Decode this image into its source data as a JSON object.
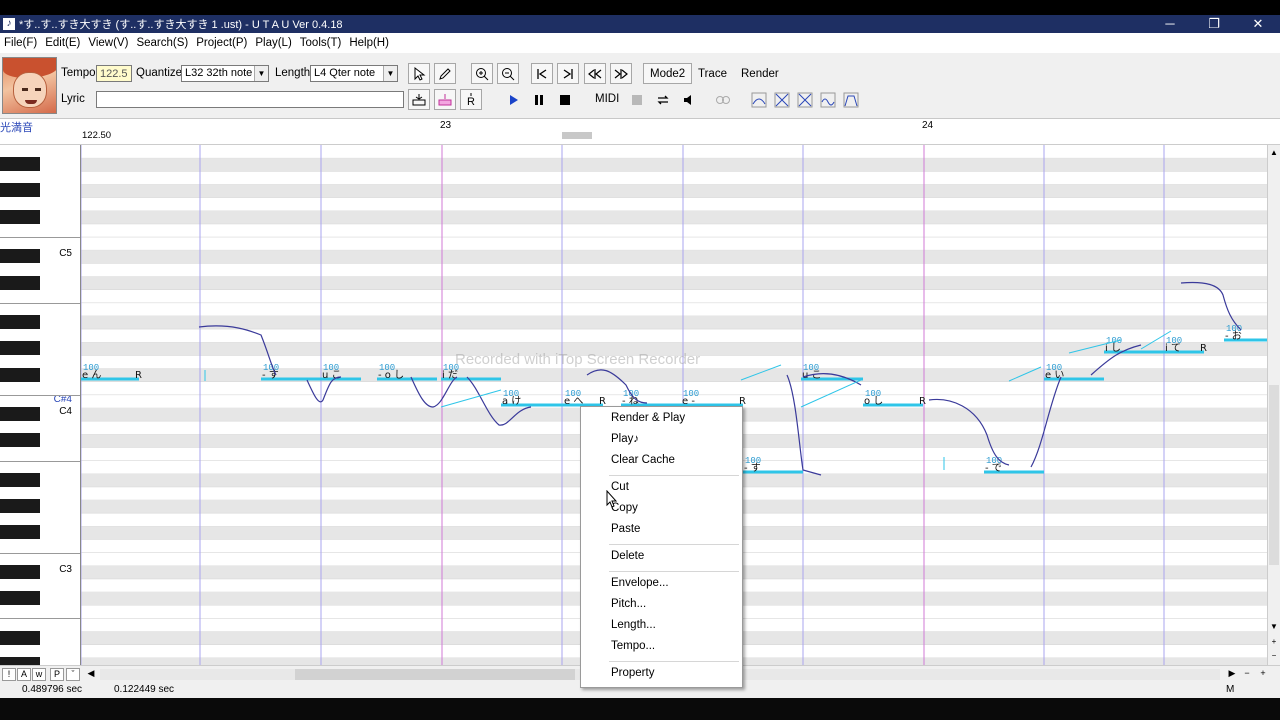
{
  "window": {
    "title": "*す..す..すき大すき (す..す..すき大すき 1 .ust) - U T A U Ver 0.4.18",
    "app_icon": "♪",
    "minimize": "─",
    "maximize": "❐",
    "close": "✕"
  },
  "menu": [
    "File(F)",
    "Edit(E)",
    "View(V)",
    "Search(S)",
    "Project(P)",
    "Play(L)",
    "Tools(T)",
    "Help(H)"
  ],
  "toolbar": {
    "tempo_label": "Tempo",
    "tempo_value": "122.5",
    "quantize_label": "Quantize",
    "quantize_value": "L32 32th note",
    "length_label": "Length",
    "length_value": "L4  Qter note",
    "lyric_label": "Lyric",
    "lyric_value": "",
    "mode2": "Mode2",
    "trace": "Trace",
    "render": "Render",
    "midi": "MIDI",
    "icons": [
      "arrow-pointer-icon",
      "pencil-icon",
      "zoom-in-icon",
      "zoom-out-icon",
      "jump-start-icon",
      "jump-end-icon",
      "prev-note-icon",
      "next-note-icon",
      "insert-note-icon",
      "insert-rest-icon",
      "rest-r-icon",
      "play-icon",
      "pause-icon",
      "stop-icon",
      "record-icon",
      "loop-icon",
      "speaker-icon",
      "midi-link-icon",
      "plugin-1-icon",
      "plugin-2-icon",
      "plugin-3-icon",
      "plugin-4-icon",
      "plugin-5-icon"
    ]
  },
  "ruler": {
    "singer": "光満音",
    "tempo_mark": "122.50",
    "bar_23": "23",
    "bar_24": "24"
  },
  "piano": {
    "c5": "C5",
    "cs4": "C#4",
    "c4": "C4",
    "c3": "C3"
  },
  "notes": [
    {
      "lyric": "e ん",
      "extra": "R",
      "vel": "100"
    },
    {
      "lyric": "- す",
      "vel": "100"
    },
    {
      "lyric": "u こ",
      "vel": "100"
    },
    {
      "lyric": "- o し",
      "vel": "100"
    },
    {
      "lyric": "i だ",
      "vel": "100"
    },
    {
      "lyric": "a け",
      "vel": "100"
    },
    {
      "lyric": "e へ",
      "extra": "R",
      "vel": "100"
    },
    {
      "lyric": "- ね",
      "vel": "100"
    },
    {
      "lyric": "e -",
      "extra": "R",
      "vel": "100"
    },
    {
      "lyric": "- す",
      "vel": "100"
    },
    {
      "lyric": "u こ",
      "vel": "100"
    },
    {
      "lyric": "o し",
      "extra": "R",
      "vel": "100"
    },
    {
      "lyric": "- で",
      "vel": "100"
    },
    {
      "lyric": "e い",
      "vel": "100"
    },
    {
      "lyric": "i し",
      "vel": "100"
    },
    {
      "lyric": "i て",
      "extra": "R",
      "vel": "100"
    },
    {
      "lyric": "- お",
      "vel": "100"
    }
  ],
  "watermark": "Recorded with iTop Screen Recorder",
  "context_menu": {
    "render_play": "Render & Play",
    "play": "Play♪",
    "clear_cache": "Clear Cache",
    "cut": "Cut",
    "copy": "Copy",
    "paste": "Paste",
    "delete": "Delete",
    "envelope": "Envelope...",
    "pitch": "Pitch...",
    "length": "Length...",
    "tempo": "Tempo...",
    "property": "Property"
  },
  "bottom_tabs": [
    "!",
    "A",
    "w",
    "P",
    "ˇ"
  ],
  "status": {
    "time1": "0.489796 sec",
    "time2": "0.122449 sec",
    "mode": "M"
  },
  "colors": {
    "title_bg": "#1e2f63",
    "note_line": "#2ec5e8",
    "pitch_curve": "#3a3a9a",
    "bar_line": "#d07ad6",
    "beat_line": "#a9a4ef"
  }
}
